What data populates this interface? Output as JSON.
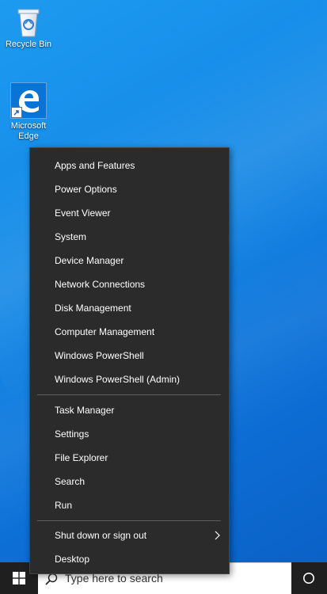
{
  "desktop": {
    "icons": [
      {
        "label": "Recycle Bin",
        "icon": "recycle-bin-icon"
      },
      {
        "label": "Microsoft Edge",
        "icon": "edge-icon"
      }
    ]
  },
  "context_menu": {
    "items": [
      {
        "label": "Apps and Features"
      },
      {
        "label": "Power Options"
      },
      {
        "label": "Event Viewer"
      },
      {
        "label": "System"
      },
      {
        "label": "Device Manager"
      },
      {
        "label": "Network Connections"
      },
      {
        "label": "Disk Management"
      },
      {
        "label": "Computer Management"
      },
      {
        "label": "Windows PowerShell"
      },
      {
        "label": "Windows PowerShell (Admin)"
      },
      {
        "label": "Task Manager"
      },
      {
        "label": "Settings"
      },
      {
        "label": "File Explorer"
      },
      {
        "label": "Search"
      },
      {
        "label": "Run"
      },
      {
        "label": "Shut down or sign out",
        "icon": "chevron-right-icon"
      },
      {
        "label": "Desktop"
      }
    ]
  },
  "taskbar": {
    "start_icon": "windows-logo-icon",
    "search_icon": "search-icon",
    "search_placeholder": "Type here to search",
    "cortana_icon": "cortana-circle-icon"
  },
  "colors": {
    "menu_background": "#2b2b2b",
    "menu_text": "#ffffff",
    "desktop_blue": "#1388e6",
    "taskbar_dark": "#1f1f1f"
  }
}
